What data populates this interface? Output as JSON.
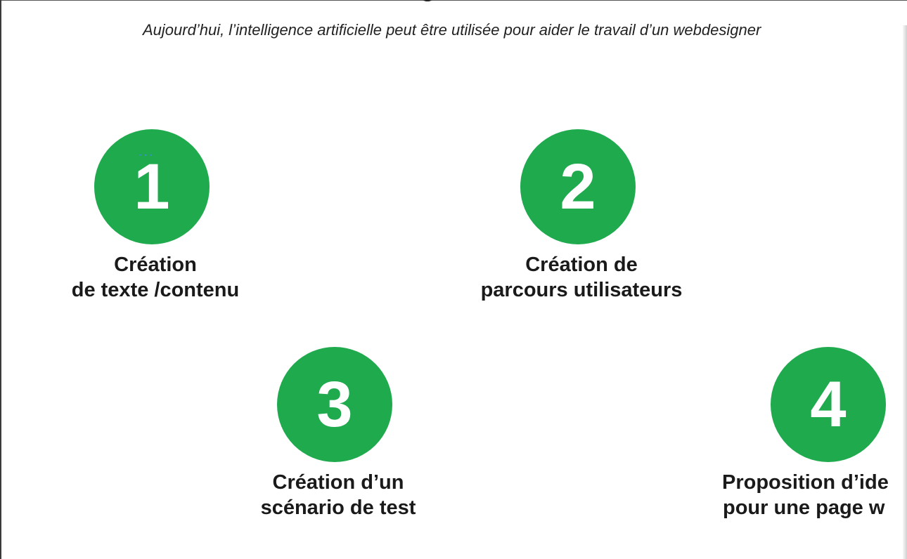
{
  "subtitle": "Aujourd’hui, l’intelligence artificielle peut être utilisée pour aider le travail d’un webdesigner",
  "accent_color": "#1faa4e",
  "items": [
    {
      "number": "1",
      "line1": "Création",
      "line2": "de texte /contenu"
    },
    {
      "number": "2",
      "line1": "Création de",
      "line2": "parcours utilisateurs"
    },
    {
      "number": "3",
      "line1": "Création d’un",
      "line2": "scénario de test"
    },
    {
      "number": "4",
      "line1": "Proposition d’ide",
      "line2": "pour une page w"
    }
  ]
}
